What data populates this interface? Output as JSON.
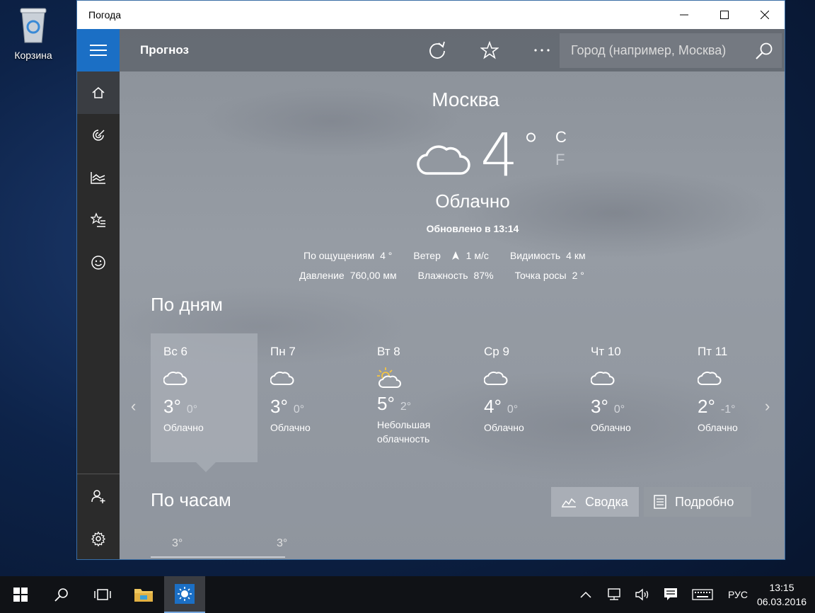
{
  "desktop": {
    "recycle_bin_label": "Корзина"
  },
  "window": {
    "title": "Погода"
  },
  "topbar": {
    "heading": "Прогноз",
    "search_placeholder": "Город (например, Москва)"
  },
  "current": {
    "city": "Москва",
    "temperature": "4",
    "degree": "°",
    "unit_c": "C",
    "unit_f": "F",
    "condition": "Облачно",
    "updated": "Обновлено в 13:14",
    "details": [
      {
        "label": "По ощущениям",
        "value": "4 °"
      },
      {
        "label": "Ветер",
        "value": "1 м/с"
      },
      {
        "label": "Видимость",
        "value": "4 км"
      },
      {
        "label": "Давление",
        "value": "760,00 мм"
      },
      {
        "label": "Влажность",
        "value": "87%"
      },
      {
        "label": "Точка росы",
        "value": "2 °"
      }
    ]
  },
  "daily": {
    "title": "По дням",
    "days": [
      {
        "name": "Вс 6",
        "hi": "3°",
        "lo": "0°",
        "cond": "Облачно",
        "icon": "cloud"
      },
      {
        "name": "Пн 7",
        "hi": "3°",
        "lo": "0°",
        "cond": "Облачно",
        "icon": "cloud"
      },
      {
        "name": "Вт 8",
        "hi": "5°",
        "lo": "2°",
        "cond": "Небольшая облачность",
        "icon": "partly-sunny"
      },
      {
        "name": "Ср 9",
        "hi": "4°",
        "lo": "0°",
        "cond": "Облачно",
        "icon": "cloud"
      },
      {
        "name": "Чт 10",
        "hi": "3°",
        "lo": "0°",
        "cond": "Облачно",
        "icon": "cloud"
      },
      {
        "name": "Пт 11",
        "hi": "2°",
        "lo": "-1°",
        "cond": "Облачно",
        "icon": "cloud"
      }
    ]
  },
  "hourly": {
    "title": "По часам",
    "summary_label": "Сводка",
    "details_label": "Подробно",
    "temps": [
      "3°",
      "3°"
    ]
  },
  "taskbar": {
    "language": "РУС",
    "time": "13:15",
    "date": "06.03.2016"
  }
}
